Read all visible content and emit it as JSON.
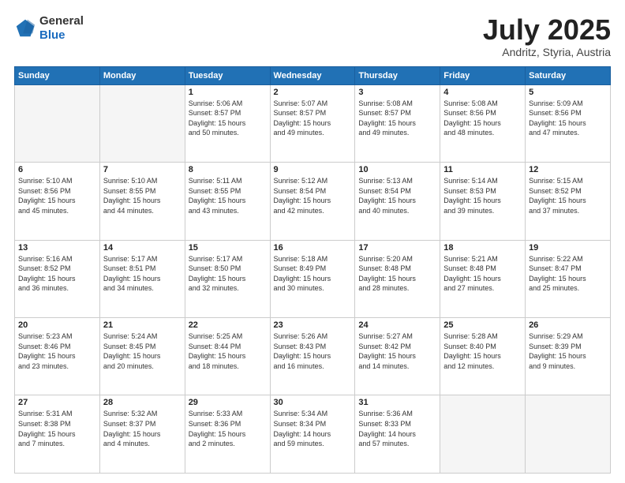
{
  "header": {
    "logo": {
      "general": "General",
      "blue": "Blue"
    },
    "title": "July 2025",
    "location": "Andritz, Styria, Austria"
  },
  "days_of_week": [
    "Sunday",
    "Monday",
    "Tuesday",
    "Wednesday",
    "Thursday",
    "Friday",
    "Saturday"
  ],
  "weeks": [
    [
      {
        "day": "",
        "info": ""
      },
      {
        "day": "",
        "info": ""
      },
      {
        "day": "1",
        "info": "Sunrise: 5:06 AM\nSunset: 8:57 PM\nDaylight: 15 hours\nand 50 minutes."
      },
      {
        "day": "2",
        "info": "Sunrise: 5:07 AM\nSunset: 8:57 PM\nDaylight: 15 hours\nand 49 minutes."
      },
      {
        "day": "3",
        "info": "Sunrise: 5:08 AM\nSunset: 8:57 PM\nDaylight: 15 hours\nand 49 minutes."
      },
      {
        "day": "4",
        "info": "Sunrise: 5:08 AM\nSunset: 8:56 PM\nDaylight: 15 hours\nand 48 minutes."
      },
      {
        "day": "5",
        "info": "Sunrise: 5:09 AM\nSunset: 8:56 PM\nDaylight: 15 hours\nand 47 minutes."
      }
    ],
    [
      {
        "day": "6",
        "info": "Sunrise: 5:10 AM\nSunset: 8:56 PM\nDaylight: 15 hours\nand 45 minutes."
      },
      {
        "day": "7",
        "info": "Sunrise: 5:10 AM\nSunset: 8:55 PM\nDaylight: 15 hours\nand 44 minutes."
      },
      {
        "day": "8",
        "info": "Sunrise: 5:11 AM\nSunset: 8:55 PM\nDaylight: 15 hours\nand 43 minutes."
      },
      {
        "day": "9",
        "info": "Sunrise: 5:12 AM\nSunset: 8:54 PM\nDaylight: 15 hours\nand 42 minutes."
      },
      {
        "day": "10",
        "info": "Sunrise: 5:13 AM\nSunset: 8:54 PM\nDaylight: 15 hours\nand 40 minutes."
      },
      {
        "day": "11",
        "info": "Sunrise: 5:14 AM\nSunset: 8:53 PM\nDaylight: 15 hours\nand 39 minutes."
      },
      {
        "day": "12",
        "info": "Sunrise: 5:15 AM\nSunset: 8:52 PM\nDaylight: 15 hours\nand 37 minutes."
      }
    ],
    [
      {
        "day": "13",
        "info": "Sunrise: 5:16 AM\nSunset: 8:52 PM\nDaylight: 15 hours\nand 36 minutes."
      },
      {
        "day": "14",
        "info": "Sunrise: 5:17 AM\nSunset: 8:51 PM\nDaylight: 15 hours\nand 34 minutes."
      },
      {
        "day": "15",
        "info": "Sunrise: 5:17 AM\nSunset: 8:50 PM\nDaylight: 15 hours\nand 32 minutes."
      },
      {
        "day": "16",
        "info": "Sunrise: 5:18 AM\nSunset: 8:49 PM\nDaylight: 15 hours\nand 30 minutes."
      },
      {
        "day": "17",
        "info": "Sunrise: 5:20 AM\nSunset: 8:48 PM\nDaylight: 15 hours\nand 28 minutes."
      },
      {
        "day": "18",
        "info": "Sunrise: 5:21 AM\nSunset: 8:48 PM\nDaylight: 15 hours\nand 27 minutes."
      },
      {
        "day": "19",
        "info": "Sunrise: 5:22 AM\nSunset: 8:47 PM\nDaylight: 15 hours\nand 25 minutes."
      }
    ],
    [
      {
        "day": "20",
        "info": "Sunrise: 5:23 AM\nSunset: 8:46 PM\nDaylight: 15 hours\nand 23 minutes."
      },
      {
        "day": "21",
        "info": "Sunrise: 5:24 AM\nSunset: 8:45 PM\nDaylight: 15 hours\nand 20 minutes."
      },
      {
        "day": "22",
        "info": "Sunrise: 5:25 AM\nSunset: 8:44 PM\nDaylight: 15 hours\nand 18 minutes."
      },
      {
        "day": "23",
        "info": "Sunrise: 5:26 AM\nSunset: 8:43 PM\nDaylight: 15 hours\nand 16 minutes."
      },
      {
        "day": "24",
        "info": "Sunrise: 5:27 AM\nSunset: 8:42 PM\nDaylight: 15 hours\nand 14 minutes."
      },
      {
        "day": "25",
        "info": "Sunrise: 5:28 AM\nSunset: 8:40 PM\nDaylight: 15 hours\nand 12 minutes."
      },
      {
        "day": "26",
        "info": "Sunrise: 5:29 AM\nSunset: 8:39 PM\nDaylight: 15 hours\nand 9 minutes."
      }
    ],
    [
      {
        "day": "27",
        "info": "Sunrise: 5:31 AM\nSunset: 8:38 PM\nDaylight: 15 hours\nand 7 minutes."
      },
      {
        "day": "28",
        "info": "Sunrise: 5:32 AM\nSunset: 8:37 PM\nDaylight: 15 hours\nand 4 minutes."
      },
      {
        "day": "29",
        "info": "Sunrise: 5:33 AM\nSunset: 8:36 PM\nDaylight: 15 hours\nand 2 minutes."
      },
      {
        "day": "30",
        "info": "Sunrise: 5:34 AM\nSunset: 8:34 PM\nDaylight: 14 hours\nand 59 minutes."
      },
      {
        "day": "31",
        "info": "Sunrise: 5:36 AM\nSunset: 8:33 PM\nDaylight: 14 hours\nand 57 minutes."
      },
      {
        "day": "",
        "info": ""
      },
      {
        "day": "",
        "info": ""
      }
    ]
  ]
}
